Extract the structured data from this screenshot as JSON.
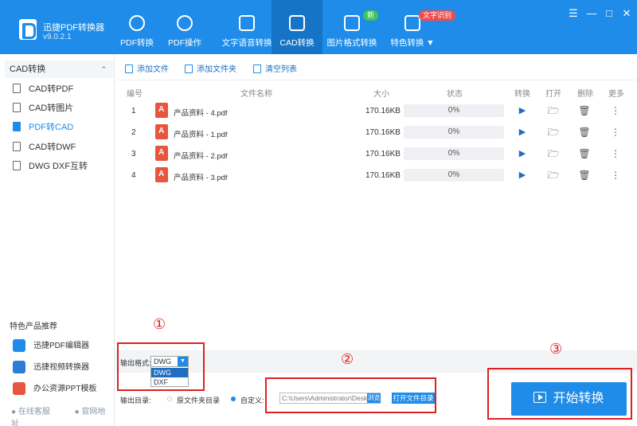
{
  "app": {
    "name": "迅捷PDF转换器",
    "version": "v9.0.2.1"
  },
  "nav": {
    "tabs": [
      {
        "label": "PDF转换",
        "icon": "convert-arrows-icon"
      },
      {
        "label": "PDF操作",
        "icon": "gear-icon"
      },
      {
        "label": "文字语音转换",
        "icon": "audio-wave-icon"
      },
      {
        "label": "CAD转换",
        "icon": "cad-icon",
        "active": true
      },
      {
        "label": "图片格式转换",
        "icon": "image-icon"
      },
      {
        "label": "特色转换 ▼",
        "icon": "star-box-icon"
      }
    ],
    "badge_new": "新",
    "badge_ocr": "文字识别"
  },
  "window": {
    "menu": "☰",
    "minimize": "—",
    "maximize": "□",
    "close": "✕"
  },
  "sidebar": {
    "section_title": "CAD转换",
    "collapse": "⌃",
    "items": [
      {
        "label": "CAD转PDF"
      },
      {
        "label": "CAD转图片"
      },
      {
        "label": "PDF转CAD",
        "active": true
      },
      {
        "label": "CAD转DWF"
      },
      {
        "label": "DWG DXF互转"
      }
    ],
    "promo_title": "特色产品推荐",
    "promo_items": [
      {
        "label": "迅捷PDF编辑器",
        "color": "#1e8ce8"
      },
      {
        "label": "迅捷视频转换器",
        "color": "#2a7ed3"
      },
      {
        "label": "办公资源PPT模板",
        "color": "#e8553e"
      }
    ],
    "footer_service": "在线客服",
    "footer_site": "官网地址"
  },
  "toolbar": {
    "add_file": "添加文件",
    "add_folder": "添加文件夹",
    "clear_list": "清空列表"
  },
  "table": {
    "headers": [
      "编号",
      "文件名称",
      "大小",
      "状态",
      "转换",
      "打开",
      "删除",
      "更多"
    ],
    "rows": [
      {
        "num": "1",
        "name": "产品资料 - 4.pdf",
        "size": "170.16KB",
        "status": "0%"
      },
      {
        "num": "2",
        "name": "产品资料 - 1.pdf",
        "size": "170.16KB",
        "status": "0%"
      },
      {
        "num": "3",
        "name": "产品资料 - 2.pdf",
        "size": "170.16KB",
        "status": "0%"
      },
      {
        "num": "4",
        "name": "产品资料 - 3.pdf",
        "size": "170.16KB",
        "status": "0%"
      }
    ],
    "icons": {
      "play": "▶",
      "folder": "🗁",
      "trash": "🗑",
      "more": "⋮"
    }
  },
  "output": {
    "format_label": "输出格式:",
    "format_value": "DWG",
    "format_options": [
      "DWG",
      "DXF"
    ],
    "dir_label": "输出目录:",
    "radio_source": "原文件夹目录",
    "radio_custom": "自定义:",
    "path_value": "C:\\Users\\Administrator\\Desktop",
    "browse": "浏览",
    "open_dir": "打开文件目录"
  },
  "start_button": "开始转换",
  "annotations": [
    "①",
    "②",
    "③"
  ],
  "colors": {
    "accent": "#1e8ce8",
    "annotation": "#e02020",
    "pdf": "#e8553e"
  }
}
